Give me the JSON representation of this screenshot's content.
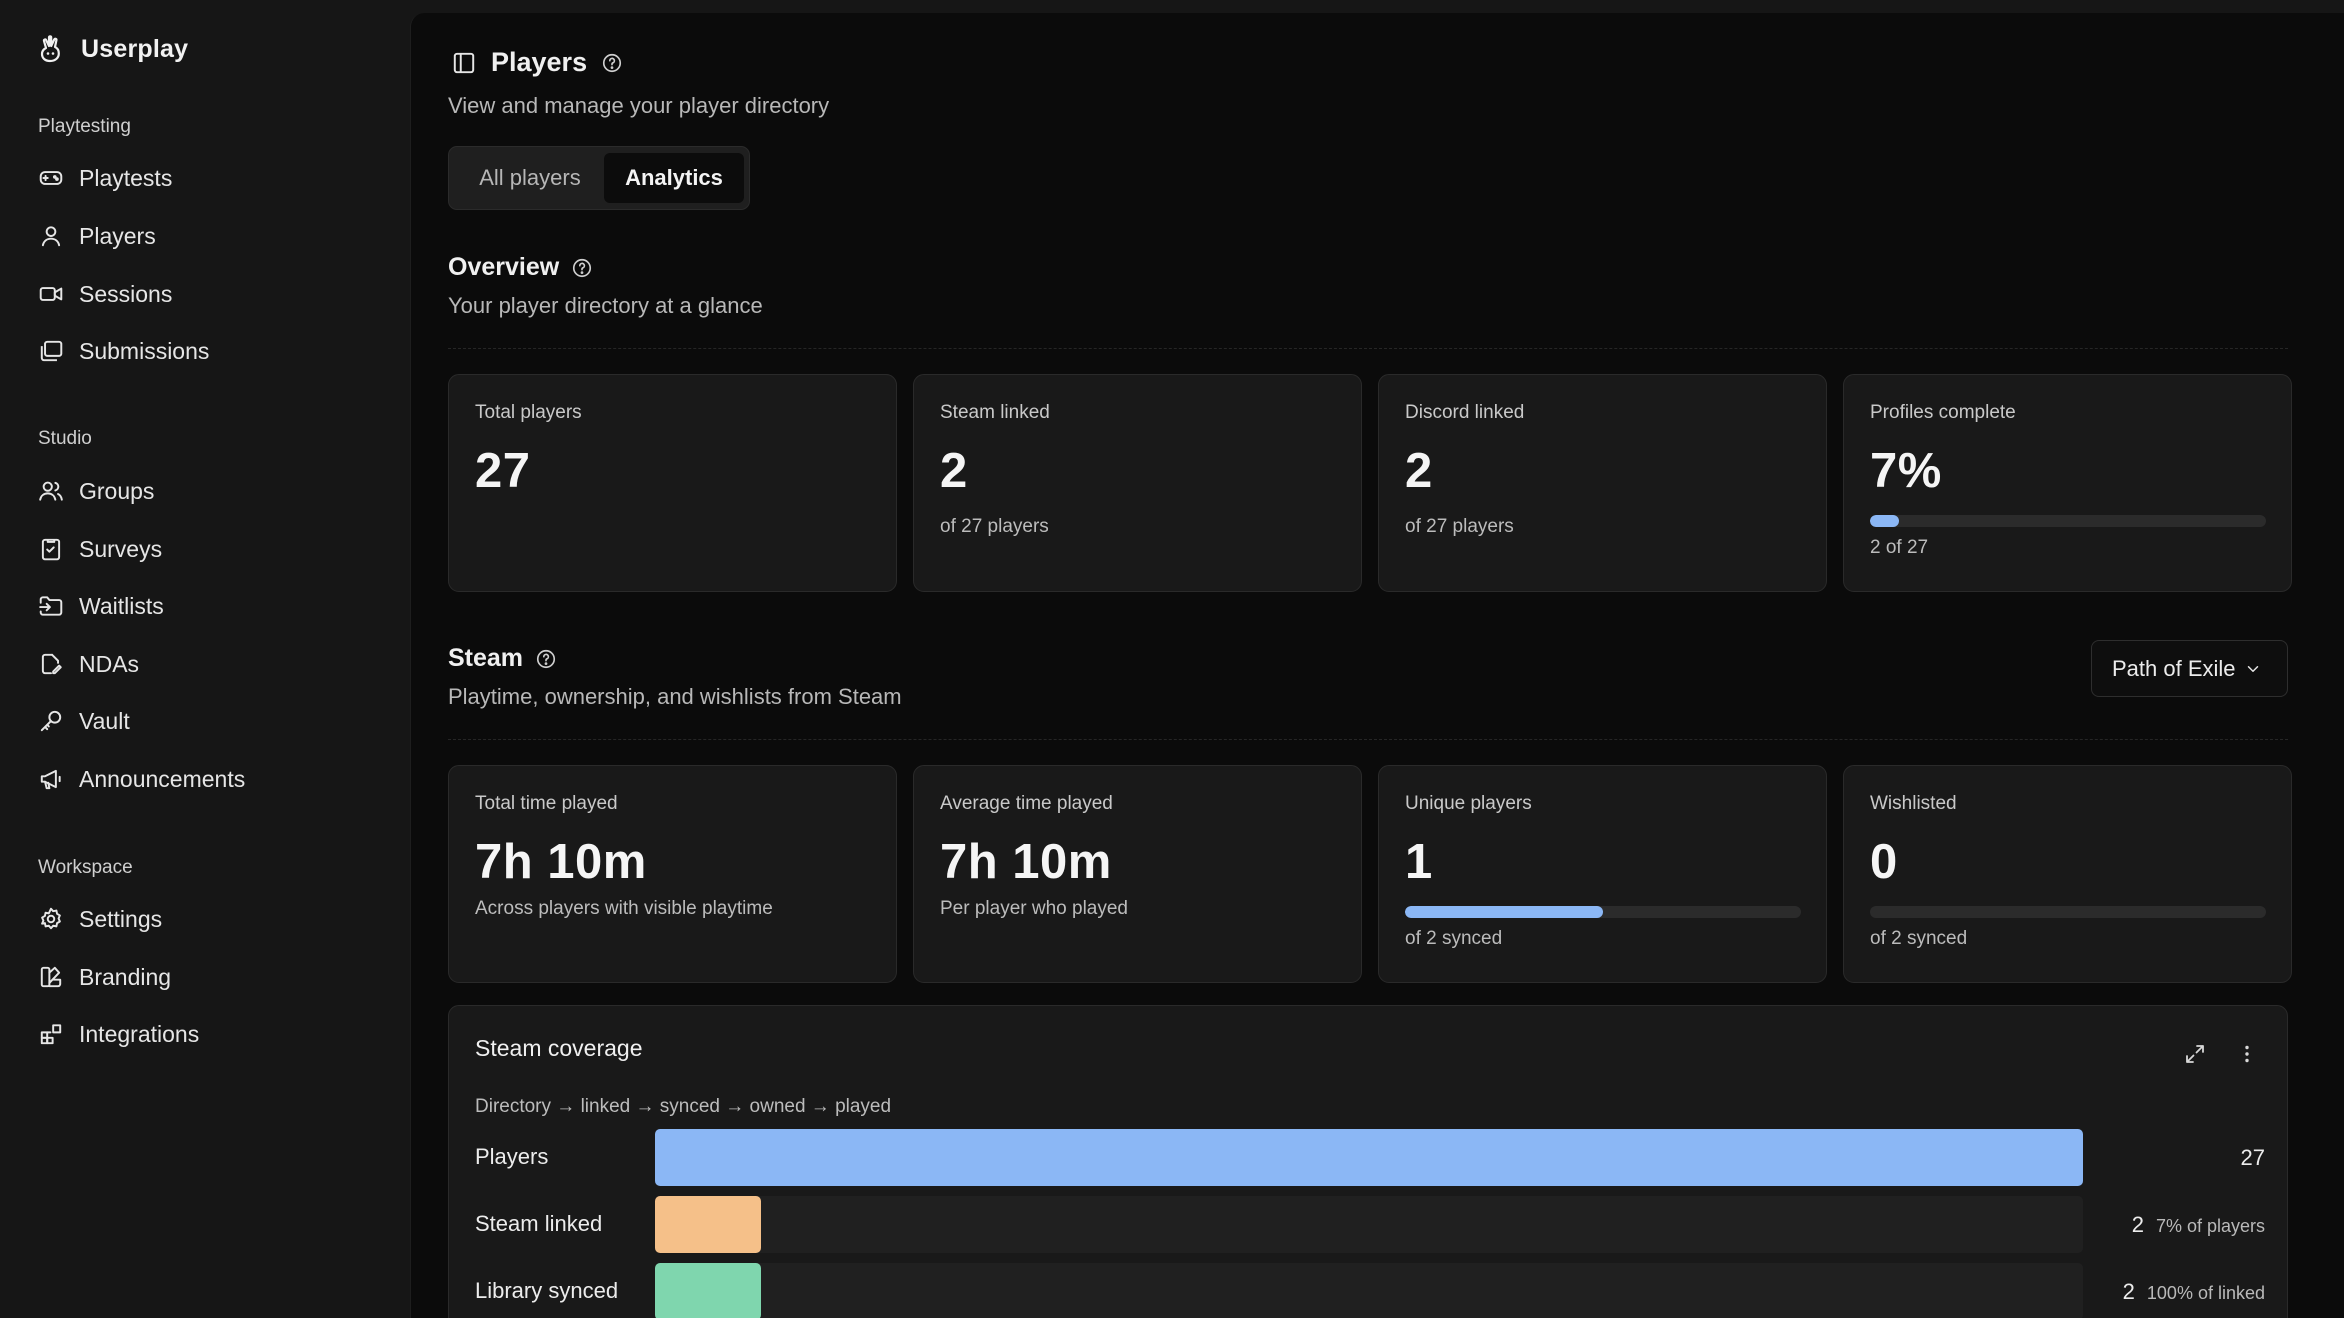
{
  "app": {
    "name": "Userplay"
  },
  "sidebar": {
    "sections": [
      {
        "label": "Playtesting",
        "items": [
          {
            "label": "Playtests",
            "icon": "gamepad-icon"
          },
          {
            "label": "Players",
            "icon": "user-icon"
          },
          {
            "label": "Sessions",
            "icon": "video-icon"
          },
          {
            "label": "Submissions",
            "icon": "stack-icon"
          }
        ]
      },
      {
        "label": "Studio",
        "items": [
          {
            "label": "Groups",
            "icon": "users-icon"
          },
          {
            "label": "Surveys",
            "icon": "survey-icon"
          },
          {
            "label": "Waitlists",
            "icon": "folder-enter-icon"
          },
          {
            "label": "NDAs",
            "icon": "file-edit-icon"
          },
          {
            "label": "Vault",
            "icon": "key-icon"
          },
          {
            "label": "Announcements",
            "icon": "megaphone-icon"
          }
        ]
      },
      {
        "label": "Workspace",
        "items": [
          {
            "label": "Settings",
            "icon": "gear-icon"
          },
          {
            "label": "Branding",
            "icon": "brush-icon"
          },
          {
            "label": "Integrations",
            "icon": "grid-plus-icon"
          }
        ]
      }
    ]
  },
  "header": {
    "title": "Players",
    "subtitle": "View and manage your player directory",
    "tabs": [
      {
        "label": "All players",
        "active": false
      },
      {
        "label": "Analytics",
        "active": true
      }
    ]
  },
  "overview": {
    "title": "Overview",
    "subtitle": "Your player directory at a glance",
    "cards": [
      {
        "label": "Total players",
        "value": "27",
        "sub": ""
      },
      {
        "label": "Steam linked",
        "value": "2",
        "sub": "of 27 players"
      },
      {
        "label": "Discord linked",
        "value": "2",
        "sub": "of 27 players"
      },
      {
        "label": "Profiles complete",
        "value": "7%",
        "sub": "2 of 27",
        "progress": 0.074
      }
    ]
  },
  "steam": {
    "title": "Steam",
    "subtitle": "Playtime, ownership, and wishlists from Steam",
    "game_select": "Path of Exile",
    "cards": [
      {
        "label": "Total time played",
        "value": "7h 10m",
        "sub": "Across players with visible playtime"
      },
      {
        "label": "Average time played",
        "value": "7h 10m",
        "sub": "Per player who played"
      },
      {
        "label": "Unique players",
        "value": "1",
        "sub": "of 2 synced",
        "progress": 0.5
      },
      {
        "label": "Wishlisted",
        "value": "0",
        "sub": "of 2 synced",
        "progress": 0
      }
    ]
  },
  "coverage": {
    "title": "Steam coverage",
    "subtitle": "Directory → linked → synced → owned → played",
    "colors": {
      "players": "#8bb7f5",
      "steam_linked": "#f5c089",
      "library_synced": "#7fd6ae"
    }
  },
  "chart_data": {
    "type": "bar",
    "categories": [
      "Players",
      "Steam linked",
      "Library synced"
    ],
    "values": [
      27,
      2,
      2
    ],
    "value_labels": [
      "27",
      "2",
      "2"
    ],
    "percent_labels": [
      "",
      "7% of players",
      "100% of linked"
    ],
    "colors": [
      "#8bb7f5",
      "#f5c089",
      "#7fd6ae"
    ],
    "max": 27
  }
}
